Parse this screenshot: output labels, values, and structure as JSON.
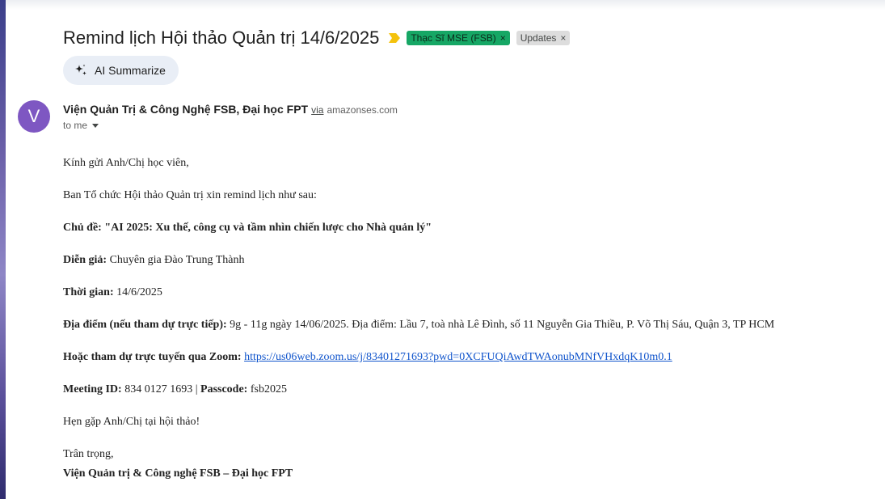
{
  "email": {
    "subject": "Remind lịch Hội thảo Quản trị 14/6/2025",
    "labels": [
      {
        "text": "Thạc Sĩ MSE (FSB)",
        "color": "#16a765"
      },
      {
        "text": "Updates",
        "color": "#dddddd"
      }
    ],
    "label_remove": "×",
    "ai_summarize_label": "AI Summarize",
    "sender": {
      "avatar_letter": "V",
      "avatar_color": "#7e57c2",
      "name": "Viện Quản Trị & Công Nghệ FSB, Đại học FPT",
      "via": "via",
      "via_domain": "amazonses.com",
      "to": "to me"
    },
    "body": {
      "greeting": "Kính gửi Anh/Chị học viên,",
      "intro": "Ban Tổ chức Hội thảo Quản trị xin remind lịch như sau:",
      "topic_label": "Chủ đề:",
      "topic_value": "\"AI 2025: Xu thế, công cụ và tầm nhìn chiến lược cho Nhà quản lý\"",
      "speaker_label": "Diễn giả:",
      "speaker_value": " Chuyên gia Đào Trung Thành",
      "time_label": "Thời gian:",
      "time_value": " 14/6/2025",
      "venue_label": "Địa điểm (nếu tham dự trực tiếp):",
      "venue_value": " 9g - 11g ngày 14/06/2025. Địa điểm: Lầu 7, toà nhà Lê Đình, số 11 Nguyễn Gia Thiều, P. Võ Thị Sáu, Quận 3, TP HCM",
      "zoom_label": "Hoặc tham dự trực tuyến qua Zoom:",
      "zoom_link": "https://us06web.zoom.us/j/83401271693?pwd=0XCFUQiAwdTWAonubMNfVHxdqK10m0.1",
      "meeting_id_label": "Meeting ID:",
      "meeting_id_value": " 834 0127 1693 | ",
      "passcode_label": "Passcode:",
      "passcode_value": " fsb2025",
      "closing": "Hẹn gặp Anh/Chị tại hội thảo!",
      "regards": "Trân trọng,",
      "signature": "Viện Quản trị & Công nghệ FSB – Đại học FPT"
    }
  }
}
